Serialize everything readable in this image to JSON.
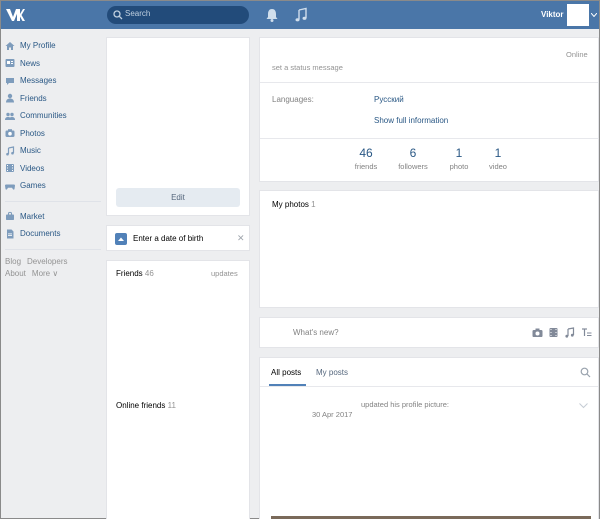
{
  "colors": {
    "topbar": "#4a76a8",
    "link": "#2a5885",
    "page_bg": "#edeef0"
  },
  "header": {
    "search_placeholder": "Search",
    "user_name": "Viktor"
  },
  "sidebar": {
    "items": [
      {
        "label": "My Profile",
        "icon": "home-icon"
      },
      {
        "label": "News",
        "icon": "news-icon"
      },
      {
        "label": "Messages",
        "icon": "messages-icon"
      },
      {
        "label": "Friends",
        "icon": "friend-icon"
      },
      {
        "label": "Communities",
        "icon": "communities-icon"
      },
      {
        "label": "Photos",
        "icon": "camera-icon"
      },
      {
        "label": "Music",
        "icon": "music-icon"
      },
      {
        "label": "Videos",
        "icon": "video-icon"
      },
      {
        "label": "Games",
        "icon": "gamepad-icon"
      }
    ],
    "items2": [
      {
        "label": "Market",
        "icon": "market-icon"
      },
      {
        "label": "Documents",
        "icon": "document-icon"
      }
    ],
    "footer": [
      "Blog",
      "Developers",
      "About",
      "More ∨"
    ]
  },
  "left_column": {
    "edit_label": "Edit",
    "birth_prompt": "Enter a date of birth",
    "close_glyph": "✕",
    "friends_title": "Friends",
    "friends_count": "46",
    "friends_updates": "updates",
    "online_title": "Online friends",
    "online_count": "11"
  },
  "profile": {
    "online_status": "Online",
    "status_placeholder": "set a status message",
    "languages_label": "Languages:",
    "languages_value": "Русский",
    "show_full": "Show full information",
    "counters": [
      {
        "num": "46",
        "label": "friends"
      },
      {
        "num": "6",
        "label": "followers"
      },
      {
        "num": "1",
        "label": "photo"
      },
      {
        "num": "1",
        "label": "video"
      }
    ]
  },
  "photos": {
    "title": "My photos",
    "count": "1"
  },
  "composer": {
    "placeholder": "What's new?"
  },
  "wall": {
    "tabs": [
      "All posts",
      "My posts"
    ],
    "post_action": "updated his profile picture:",
    "post_date": "30 Apr 2017"
  }
}
